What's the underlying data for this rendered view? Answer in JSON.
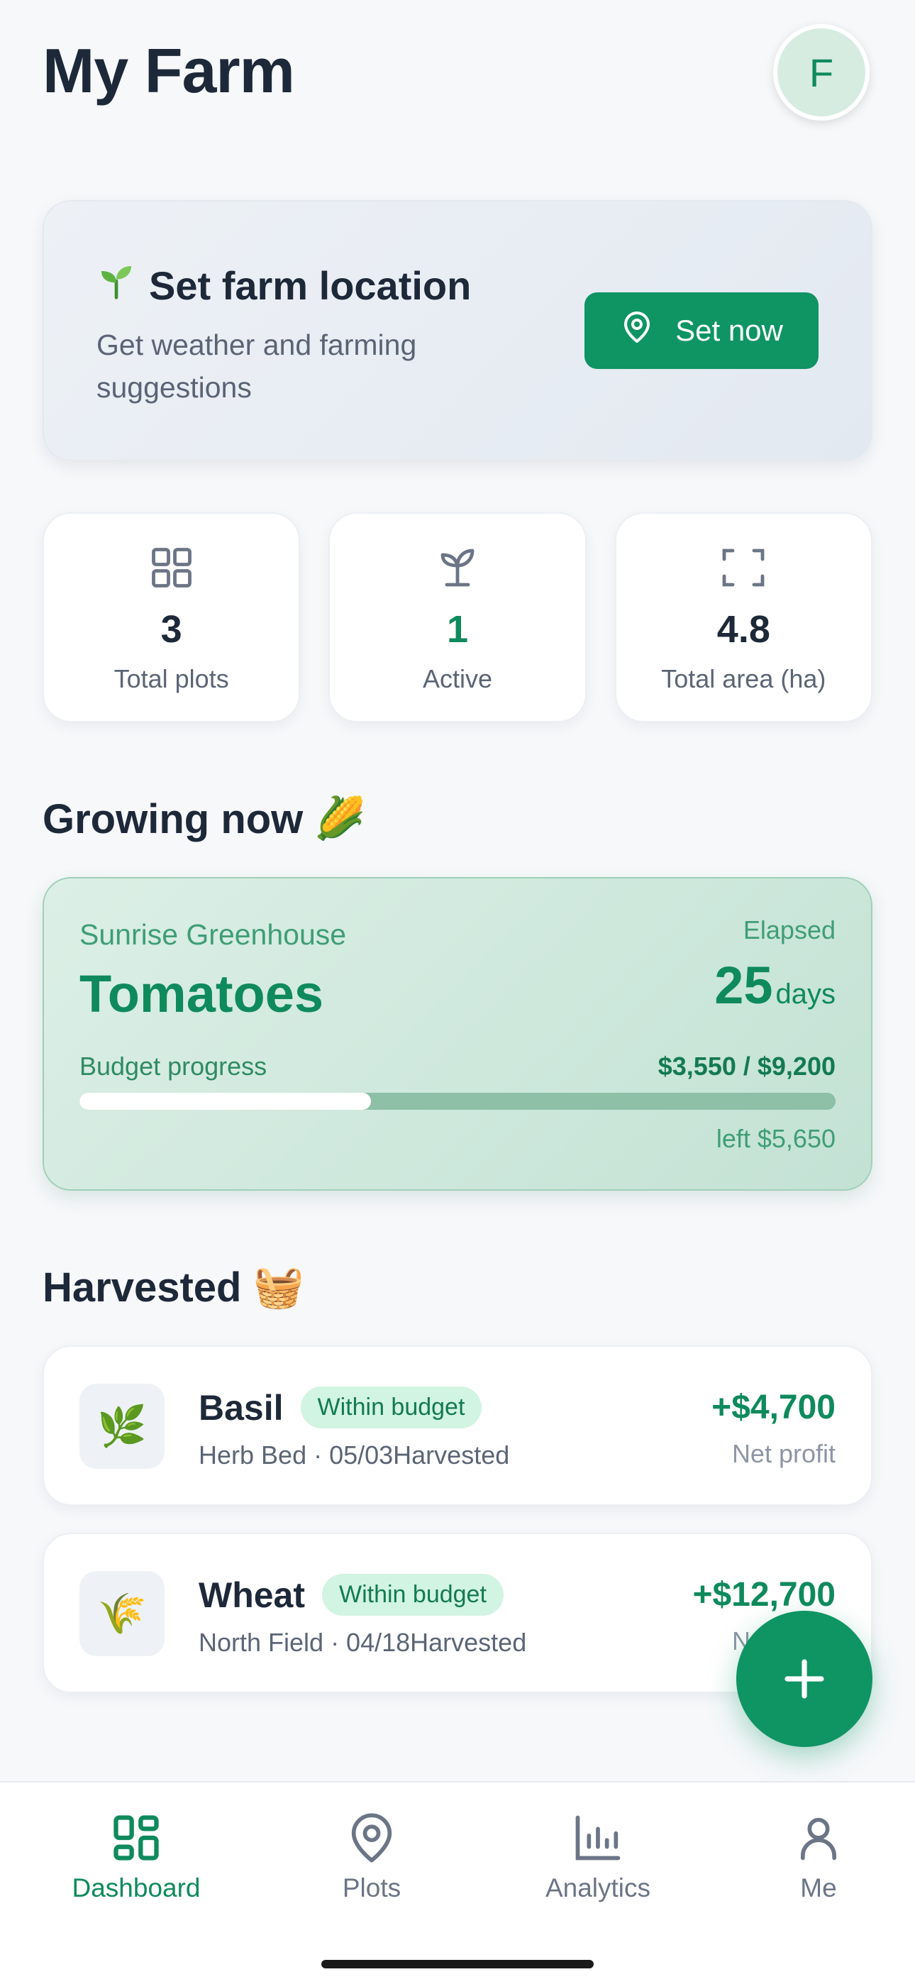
{
  "header": {
    "title": "My Farm",
    "avatar_initial": "F"
  },
  "location_card": {
    "icon": "seedling-emoji",
    "title": "Set farm location",
    "subtitle": "Get weather and farming suggestions",
    "button_label": "Set now"
  },
  "stats": [
    {
      "icon": "grid-icon",
      "value": "3",
      "label": "Total plots"
    },
    {
      "icon": "sprout-icon",
      "value": "1",
      "label": "Active"
    },
    {
      "icon": "frame-corners-icon",
      "value": "4.8",
      "label": "Total area (ha)"
    }
  ],
  "growing": {
    "heading": "Growing now",
    "heading_emoji": "🌽",
    "plot": "Sunrise Greenhouse",
    "crop": "Tomatoes",
    "elapsed_label": "Elapsed",
    "elapsed_value": "25",
    "elapsed_unit": "days",
    "budget_label": "Budget progress",
    "budget_amount": "$3,550 / $9,200",
    "budget_progress": 0.386,
    "left_amount": "left $5,650"
  },
  "harvested": {
    "heading": "Harvested",
    "heading_emoji": "🧺",
    "items": [
      {
        "emoji": "🌿",
        "name": "Basil",
        "badge": "Within budget",
        "meta": "Herb Bed · 05/03Harvested",
        "profit": "+$4,700",
        "profit_label": "Net profit"
      },
      {
        "emoji": "🌾",
        "name": "Wheat",
        "badge": "Within budget",
        "meta": "North Field · 04/18Harvested",
        "profit": "+$12,700",
        "profit_label": "Net profit"
      }
    ]
  },
  "fab": {
    "icon": "plus-icon"
  },
  "nav": [
    {
      "label": "Dashboard",
      "icon": "dashboard-icon",
      "active": true
    },
    {
      "label": "Plots",
      "icon": "map-pin-icon",
      "active": false
    },
    {
      "label": "Analytics",
      "icon": "bar-chart-icon",
      "active": false
    },
    {
      "label": "Me",
      "icon": "user-icon",
      "active": false
    }
  ],
  "colors": {
    "accent": "#0f9464",
    "text": "#1d2838",
    "muted": "#5b6575"
  }
}
